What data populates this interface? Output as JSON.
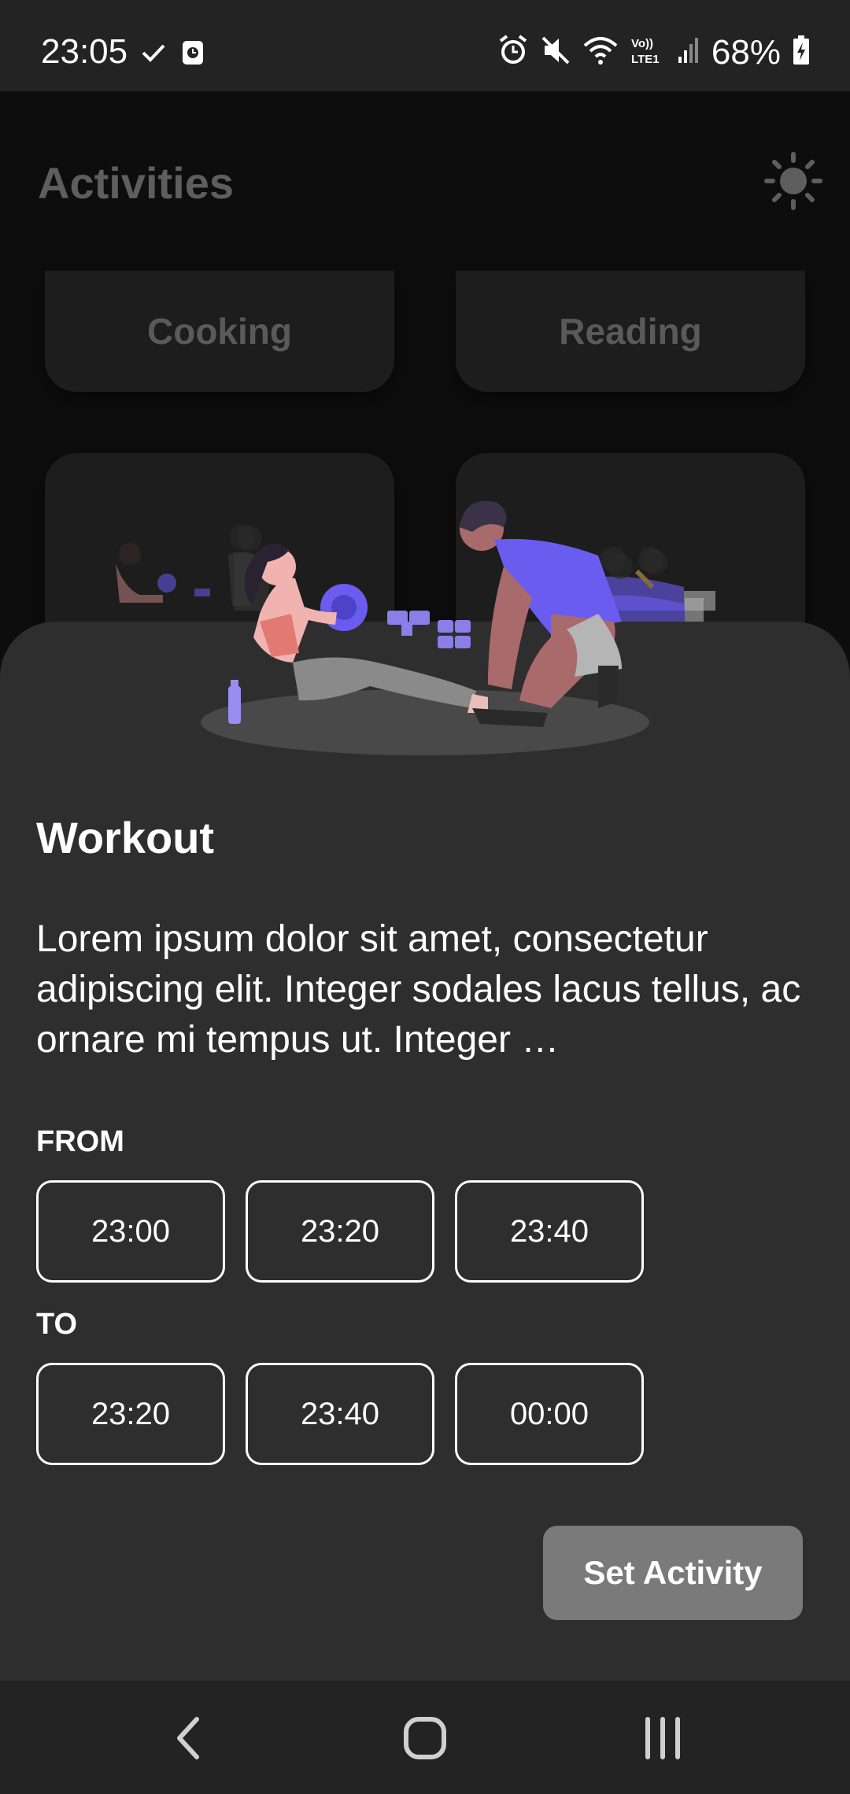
{
  "status_bar": {
    "time": "23:05",
    "battery": "68%",
    "left_icons": [
      "check-icon",
      "screenshot-icon"
    ],
    "right_icons": [
      "alarm-icon",
      "mute-icon",
      "wifi-icon",
      "volte-icon",
      "signal-icon",
      "battery-charging-icon"
    ]
  },
  "app": {
    "title": "Activities",
    "theme_icon": "sun-icon",
    "cards": [
      {
        "label": "Cooking"
      },
      {
        "label": "Reading"
      }
    ]
  },
  "sheet": {
    "title": "Workout",
    "description": "Lorem ipsum dolor sit amet, consectetur adipiscing elit. Integer sodales lacus tellus, ac ornare mi tempus ut. Integer …",
    "from_label": "FROM",
    "from_times": [
      "23:00",
      "23:20",
      "23:40"
    ],
    "to_label": "TO",
    "to_times": [
      "23:20",
      "23:40",
      "00:00"
    ],
    "button_label": "Set Activity"
  },
  "nav_bar": {
    "icons": [
      "back-icon",
      "home-icon",
      "recent-apps-icon"
    ]
  },
  "colors": {
    "background": "#0d0d0d",
    "sheet": "#2e2e2f",
    "card": "#1d1d1d",
    "accent_purple": "#6b5cf0",
    "button": "#7a7a7a"
  }
}
